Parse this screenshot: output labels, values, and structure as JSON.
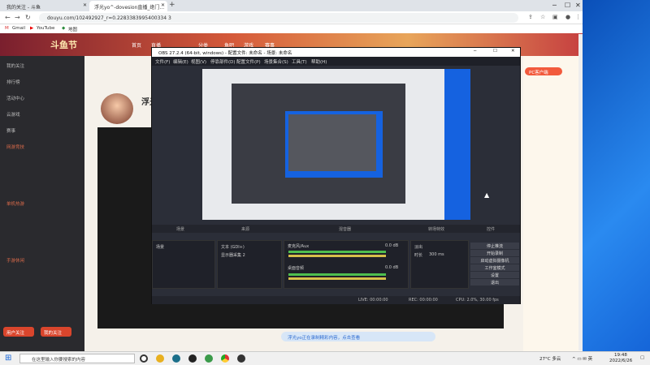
{
  "browser": {
    "tabs": [
      {
        "label": "我的关注 - 斗鱼"
      },
      {
        "label": "浮光yo^-dovesion直播_绝门..."
      }
    ],
    "url": "douyu.com/102492927_r=0.2283383995400334 3",
    "bookmarks": [
      "Gmail",
      "YouTube",
      "地图"
    ]
  },
  "site": {
    "logo": "斗鱼节",
    "nav": [
      "首页",
      "直播",
      "分类",
      "鱼吧",
      "游戏",
      "赛事"
    ],
    "left_menu": [
      "我的关注",
      "排行榜",
      "活动中心",
      "云游戏",
      "赛事"
    ],
    "left_sections": [
      "网游竞技",
      "单机热游",
      "手游休闲"
    ],
    "left_buttons": [
      "用户关注",
      "我的关注"
    ],
    "streamer_name": "浮光yo",
    "pc_badge": "PC客户端",
    "chat_placeholder": "浮光yo正在录制精彩内容，点击查看"
  },
  "obs": {
    "title": "OBS 27.2.4 (64-bit, windows) - 配置文件: 未命名 - 场景: 未命名",
    "menu": [
      "文件(F)",
      "编辑(E)",
      "视图(V)",
      "停靠部件(D)",
      "配置文件(P)",
      "场景集合(S)",
      "工具(T)",
      "帮助(H)"
    ],
    "dock_labels": [
      "场景",
      "来源",
      "混音器",
      "转场特效",
      "控件"
    ],
    "scene": "场景",
    "sources": [
      "文本 (GDI+)",
      "显示器采集 2"
    ],
    "mixer": [
      {
        "name": "麦克风/Aux",
        "level": "0.0 dB"
      },
      {
        "name": "桌面音频",
        "level": "0.0 dB"
      }
    ],
    "transition": "淡出",
    "duration_label": "时长",
    "duration": "300 ms",
    "controls": [
      "停止推流",
      "开始录制",
      "启动虚拟摄像机",
      "工作室模式",
      "设置",
      "退出"
    ],
    "status": [
      "LIVE: 00:00:00",
      "REC: 00:00:00",
      "CPU: 2.0%, 30.00 fps"
    ]
  },
  "taskbar": {
    "search_placeholder": "在这里输入你要搜索的内容",
    "weather": "27°C 多云",
    "time": "19:48",
    "date": "2022/6/26"
  }
}
